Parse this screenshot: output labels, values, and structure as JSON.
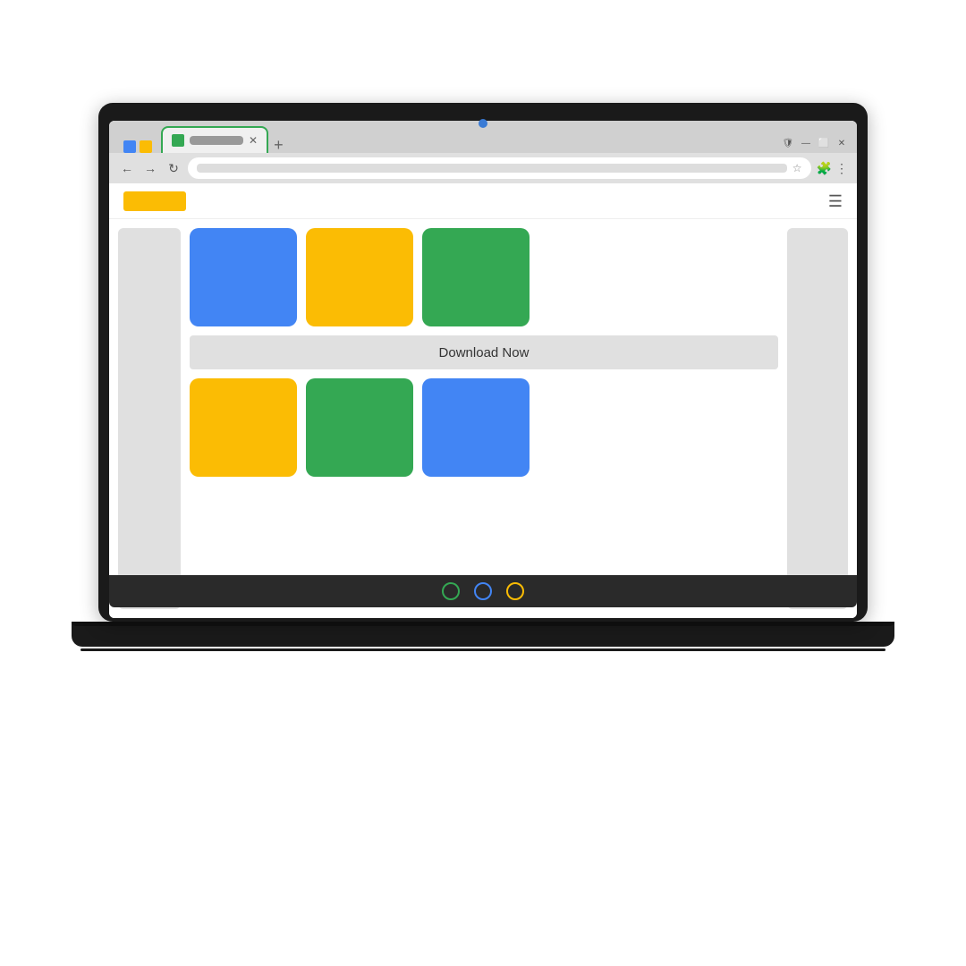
{
  "scene": {
    "background": "#ffffff"
  },
  "browser": {
    "tab": {
      "label": "",
      "active": true,
      "border_color": "#34A853"
    },
    "favicons": [
      {
        "color": "blue",
        "label": "favicon-blue"
      },
      {
        "color": "yellow",
        "label": "favicon-yellow"
      },
      {
        "color": "green",
        "label": "favicon-green"
      }
    ],
    "controls": {
      "back": "←",
      "forward": "→",
      "refresh": "↻",
      "new_tab": "+",
      "close": "✕",
      "bookmark": "☆",
      "extensions": "🧩",
      "menu": "⋮",
      "minimize": "—",
      "maximize": "⬜",
      "window_close": "✕",
      "shield": "🛡"
    }
  },
  "page": {
    "navbar": {
      "logo_color": "#FBBC04",
      "hamburger_label": "☰"
    },
    "cards_top": [
      {
        "color": "blue",
        "label": "card-blue-1"
      },
      {
        "color": "yellow",
        "label": "card-yellow-1"
      },
      {
        "color": "green",
        "label": "card-green-1"
      }
    ],
    "download_button": {
      "label": "Download Now"
    },
    "cards_bottom": [
      {
        "color": "yellow",
        "label": "card-yellow-2"
      },
      {
        "color": "green",
        "label": "card-green-2"
      },
      {
        "color": "blue",
        "label": "card-blue-2"
      }
    ]
  },
  "taskbar": {
    "dots": [
      {
        "color": "green"
      },
      {
        "color": "blue"
      },
      {
        "color": "yellow"
      }
    ]
  }
}
